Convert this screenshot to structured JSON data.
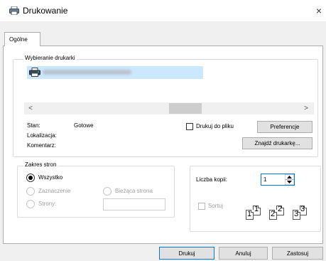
{
  "window": {
    "title": "Drukowanie",
    "close_glyph": "×",
    "icon": "printer-icon"
  },
  "tabs": [
    {
      "label": "Ogólne"
    }
  ],
  "printer_section": {
    "label": "Wybieranie drukarki",
    "selected_printer_icon": "printer-icon",
    "scroll_left": "<",
    "scroll_right": ">",
    "status_label": "Stan:",
    "status_value": "Gotowe",
    "location_label": "Lokalizacja:",
    "comment_label": "Komentarz:",
    "print_to_file_label": "Drukuj do pliku",
    "preferences_button": "Preferencje",
    "find_printer_button": "Znajdź drukarkę..."
  },
  "page_range": {
    "label": "Zakres stron",
    "all_label": "Wszystko",
    "selection_label": "Zaznaczenie",
    "current_page_label": "Bieżąca strona",
    "pages_label": "Strony:",
    "pages_value": ""
  },
  "copies": {
    "label": "Liczba kopii:",
    "value": "1",
    "collate_label": "Sortuj",
    "collate_pages": [
      "1",
      "1",
      "2",
      "2",
      "3",
      "3"
    ]
  },
  "footer": {
    "print_button": "Drukuj",
    "cancel_button": "Anuluj",
    "apply_button": "Zastosuj"
  },
  "colors": {
    "selection": "#cce8ff",
    "panel_bg": "#f0f0f0",
    "button_bg": "#e1e1e1",
    "primary_border": "#0078d7"
  }
}
